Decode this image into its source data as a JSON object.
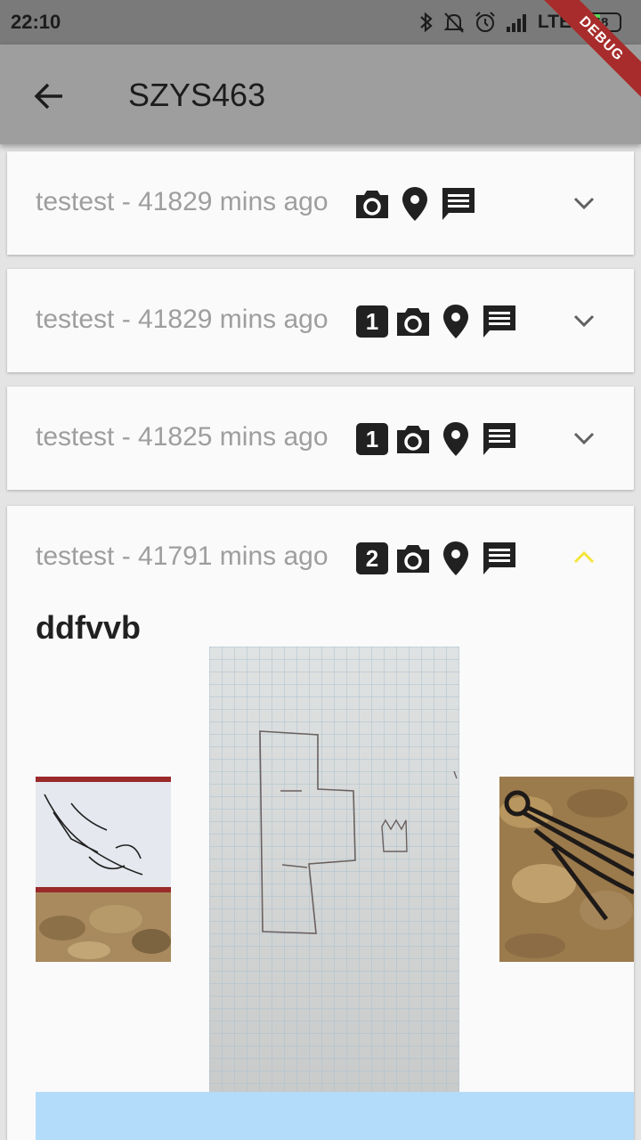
{
  "status_bar": {
    "time": "22:10",
    "network": "LTE",
    "battery_level": "48",
    "battery_fraction": 0.48,
    "icons": [
      "bluetooth-icon",
      "bell-off-icon",
      "alarm-icon",
      "signal-icon"
    ]
  },
  "debug_banner": "DEBUG",
  "app_bar": {
    "back_icon": "arrow-back-icon",
    "title": "SZYS463"
  },
  "entries": [
    {
      "title": "testest - 41829 mins ago",
      "count": "",
      "icons": [
        "camera-icon",
        "location-pin-icon",
        "message-icon"
      ],
      "expanded": false
    },
    {
      "title": "testest - 41829 mins ago",
      "count": "1",
      "icons": [
        "camera-icon",
        "location-pin-icon",
        "message-icon"
      ],
      "expanded": false
    },
    {
      "title": "testest - 41825 mins ago",
      "count": "1",
      "icons": [
        "camera-icon",
        "location-pin-icon",
        "message-icon"
      ],
      "expanded": false
    },
    {
      "title": "testest - 41791 mins ago",
      "count": "2",
      "icons": [
        "camera-icon",
        "location-pin-icon",
        "message-icon"
      ],
      "expanded": true,
      "body": "ddfvvb"
    }
  ],
  "colors": {
    "status_bar": "#7a7a7a",
    "app_bar": "#9e9e9e",
    "card": "#fafafa",
    "subtitle_text": "#9e9e9e",
    "expanded_chevron": "#f5e53a",
    "debug_ribbon": "#a82c2c",
    "blue_panel": "#b3dcfb"
  }
}
